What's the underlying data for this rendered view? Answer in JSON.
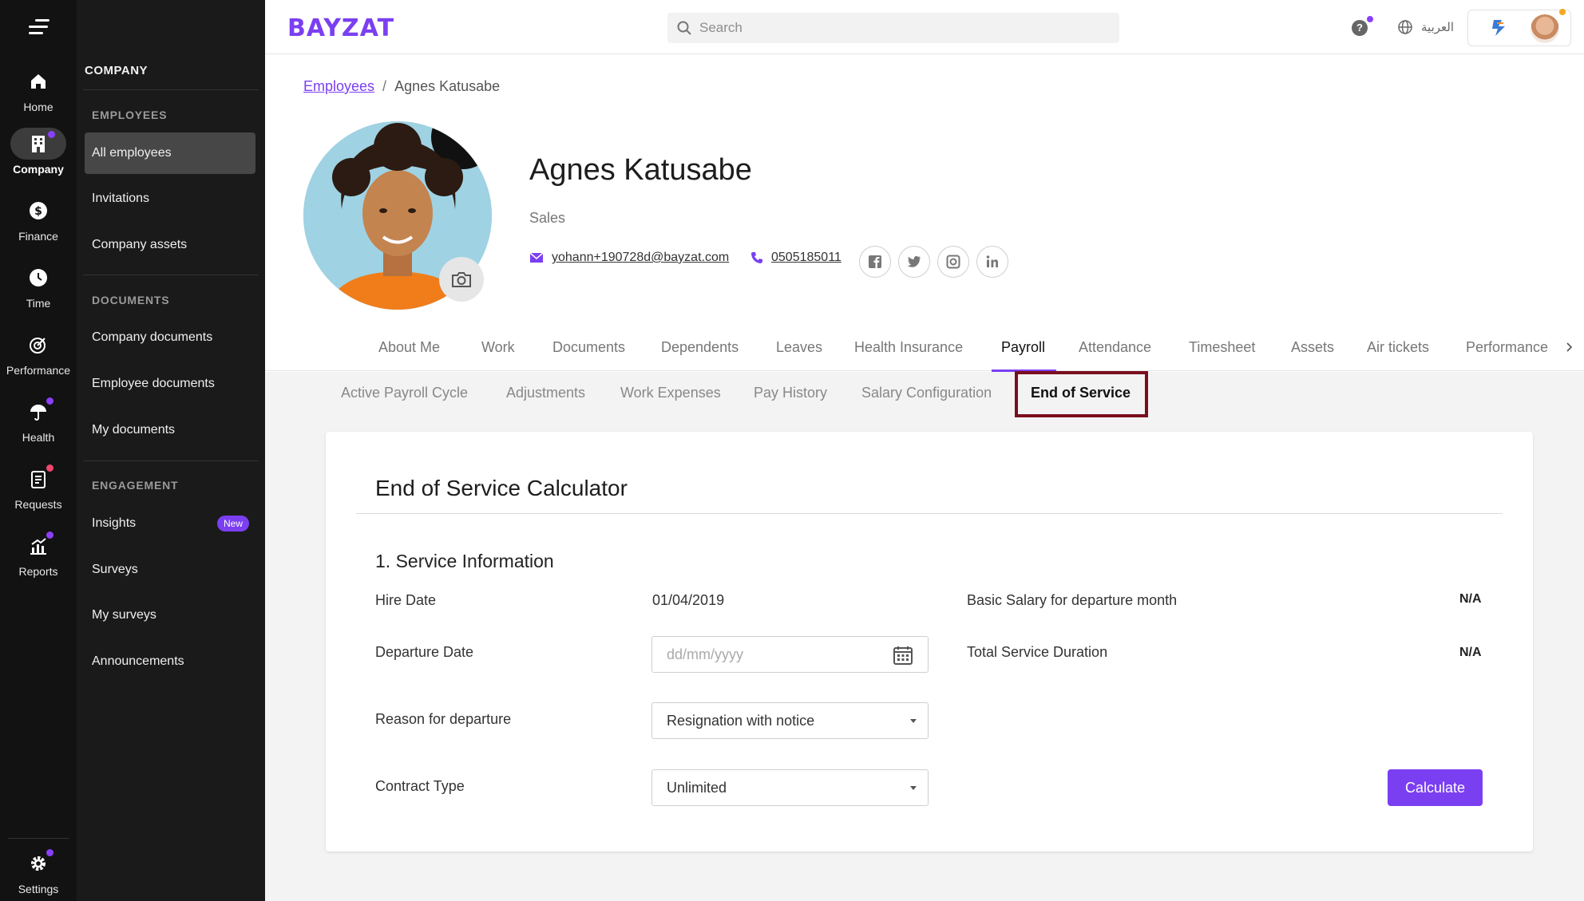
{
  "rail": {
    "items": [
      {
        "label": "Home",
        "icon": "home-icon"
      },
      {
        "label": "Company",
        "icon": "building-icon"
      },
      {
        "label": "Finance",
        "icon": "dollar-icon"
      },
      {
        "label": "Time",
        "icon": "clock-icon"
      },
      {
        "label": "Performance",
        "icon": "target-icon"
      },
      {
        "label": "Health",
        "icon": "umbrella-icon"
      },
      {
        "label": "Requests",
        "icon": "clipboard-icon"
      },
      {
        "label": "Reports",
        "icon": "chart-icon"
      },
      {
        "label": "Settings",
        "icon": "gear-icon"
      }
    ]
  },
  "sidebar": {
    "title": "COMPANY",
    "sections": {
      "employees": "EMPLOYEES",
      "documents": "DOCUMENTS",
      "engagement": "ENGAGEMENT"
    },
    "items": {
      "all_employees": "All employees",
      "invitations": "Invitations",
      "company_assets": "Company assets",
      "company_documents": "Company documents",
      "employee_documents": "Employee documents",
      "my_documents": "My documents",
      "insights": "Insights",
      "insights_badge": "New",
      "surveys": "Surveys",
      "my_surveys": "My surveys",
      "announcements": "Announcements"
    }
  },
  "header": {
    "logo": "BAYZAT",
    "search_placeholder": "Search",
    "help": "?",
    "language": "العربية"
  },
  "breadcrumb": {
    "parent": "Employees",
    "current": "Agnes Katusabe"
  },
  "profile": {
    "name": "Agnes Katusabe",
    "department": "Sales",
    "email": "yohann+190728d@bayzat.com",
    "phone": "0505185011"
  },
  "tabs": [
    "About Me",
    "Work",
    "Documents",
    "Dependents",
    "Leaves",
    "Health Insurance",
    "Payroll",
    "Attendance",
    "Timesheet",
    "Assets",
    "Air tickets",
    "Performance"
  ],
  "subtabs": [
    "Active Payroll Cycle",
    "Adjustments",
    "Work Expenses",
    "Pay History",
    "Salary Configuration",
    "End of Service"
  ],
  "calculator": {
    "title": "End of Service Calculator",
    "section_title": "1. Service Information",
    "hire_date_label": "Hire Date",
    "hire_date": "01/04/2019",
    "departure_date_label": "Departure Date",
    "departure_date_placeholder": "dd/mm/yyyy",
    "reason_label": "Reason for departure",
    "reason_value": "Resignation with notice",
    "contract_label": "Contract Type",
    "contract_value": "Unlimited",
    "basic_salary_label": "Basic Salary for departure month",
    "basic_salary_value": "N/A",
    "total_duration_label": "Total Service Duration",
    "total_duration_value": "N/A",
    "calculate_button": "Calculate"
  },
  "colors": {
    "accent": "#7b3ff2",
    "highlight": "#7a0e1e",
    "rail_bg": "#121212",
    "sidebar_bg": "#1a1a1a"
  }
}
